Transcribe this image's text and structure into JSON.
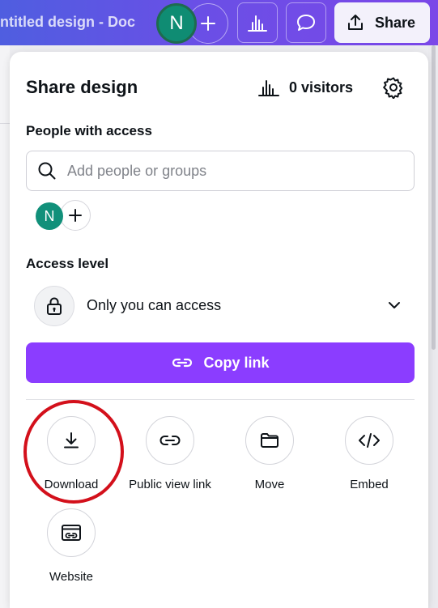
{
  "topbar": {
    "doc_title": "ntitled design - Doc",
    "avatar_initial": "N",
    "share_label": "Share"
  },
  "panel": {
    "title": "Share design",
    "visitors_label": "0 visitors",
    "people_label": "People with access",
    "search_placeholder": "Add people or groups",
    "member_initial": "N",
    "access_level_label": "Access level",
    "access_value": "Only you can access",
    "copy_link_label": "Copy link",
    "options": [
      {
        "label": "Download",
        "icon": "download-icon"
      },
      {
        "label": "Public view link",
        "icon": "link-icon"
      },
      {
        "label": "Move",
        "icon": "folder-icon"
      },
      {
        "label": "Embed",
        "icon": "code-icon"
      },
      {
        "label": "Website",
        "icon": "website-icon"
      }
    ]
  },
  "colors": {
    "accent": "#8b3dff",
    "avatar": "#11907a",
    "highlight_ring": "#d3101b"
  }
}
